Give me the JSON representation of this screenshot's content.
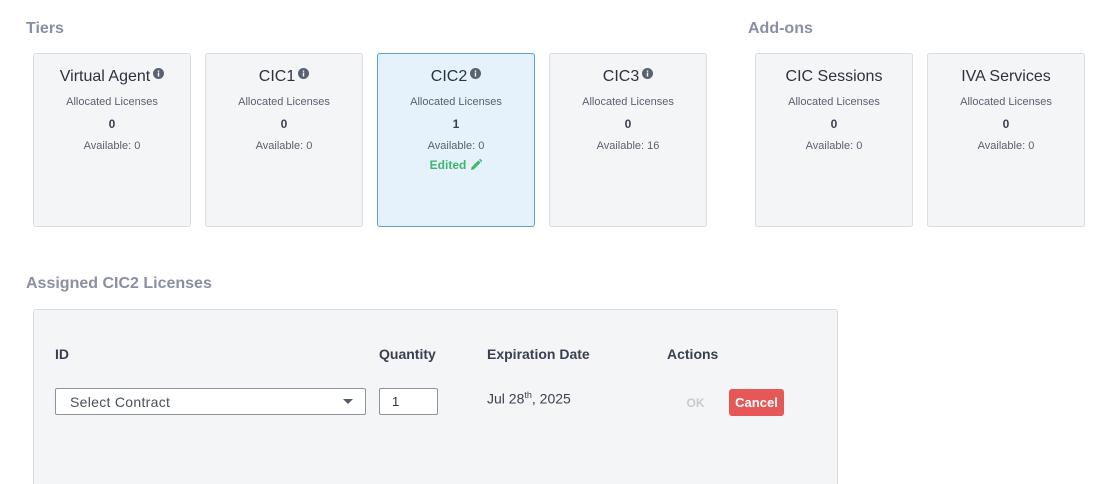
{
  "sections": {
    "tiers_title": "Tiers",
    "addons_title": "Add-ons",
    "assigned_title": "Assigned CIC2 Licenses"
  },
  "tiers": [
    {
      "name": "Virtual Agent",
      "info_icon": "info-icon",
      "allocated_label": "Allocated Licenses",
      "allocated": "0",
      "available": "Available: 0",
      "edited": ""
    },
    {
      "name": "CIC1",
      "info_icon": "info-icon",
      "allocated_label": "Allocated Licenses",
      "allocated": "0",
      "available": "Available: 0",
      "edited": ""
    },
    {
      "name": "CIC2",
      "info_icon": "info-icon",
      "allocated_label": "Allocated Licenses",
      "allocated": "1",
      "available": "Available: 0",
      "edited": "Edited",
      "selected": true
    },
    {
      "name": "CIC3",
      "info_icon": "info-icon",
      "allocated_label": "Allocated Licenses",
      "allocated": "0",
      "available": "Available: 16",
      "edited": ""
    }
  ],
  "addons": [
    {
      "name": "CIC Sessions",
      "allocated_label": "Allocated Licenses",
      "allocated": "0",
      "available": "Available: 0"
    },
    {
      "name": "IVA Services",
      "allocated_label": "Allocated Licenses",
      "allocated": "0",
      "available": "Available: 0"
    }
  ],
  "assigned": {
    "columns": {
      "id": "ID",
      "quantity": "Quantity",
      "expiration": "Expiration Date",
      "actions": "Actions"
    },
    "row": {
      "select_placeholder": "Select Contract",
      "quantity": "1",
      "expiration_prefix": "Jul 28",
      "expiration_suffix": "th",
      "expiration_year": ", 2025",
      "ok_label": "OK",
      "cancel_label": "Cancel"
    }
  },
  "colors": {
    "section_title": "#8a8fa3",
    "selected_card_bg": "#e5f1fb",
    "selected_card_border": "#5a9ed3",
    "edited": "#3cb96a",
    "cancel_bg": "#e65757"
  }
}
